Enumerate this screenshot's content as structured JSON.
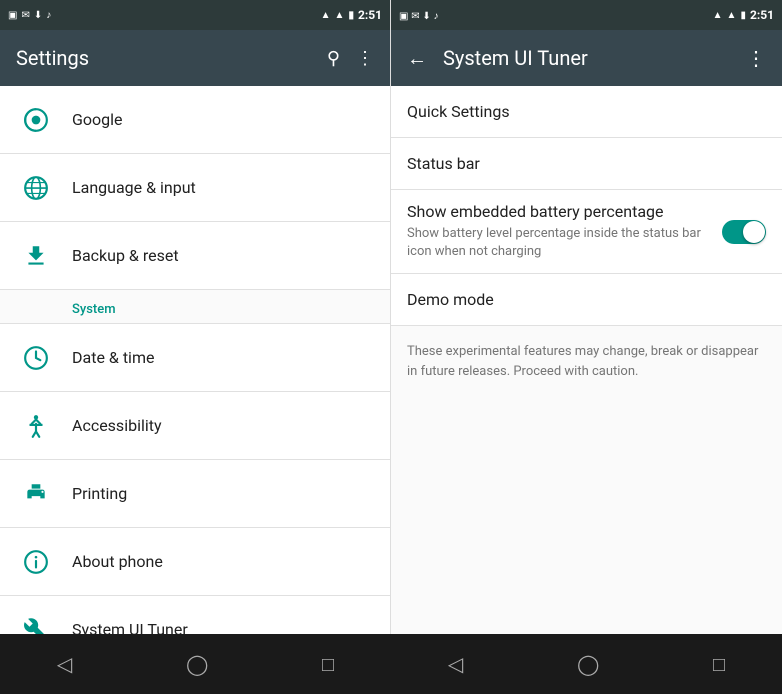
{
  "left": {
    "status_bar": {
      "time": "2:51",
      "icons": [
        "notification1",
        "notification2",
        "notification3",
        "notification4"
      ]
    },
    "header": {
      "title": "Settings",
      "search_label": "search",
      "more_label": "more options"
    },
    "items": [
      {
        "id": "google",
        "label": "Google",
        "icon": "google"
      },
      {
        "id": "language",
        "label": "Language & input",
        "icon": "language"
      },
      {
        "id": "backup",
        "label": "Backup & reset",
        "icon": "backup"
      }
    ],
    "section": "System",
    "system_items": [
      {
        "id": "datetime",
        "label": "Date & time",
        "icon": "clock"
      },
      {
        "id": "accessibility",
        "label": "Accessibility",
        "icon": "accessibility"
      },
      {
        "id": "printing",
        "label": "Printing",
        "icon": "print"
      },
      {
        "id": "about",
        "label": "About phone",
        "icon": "info"
      },
      {
        "id": "tuner",
        "label": "System UI Tuner",
        "icon": "wrench"
      }
    ]
  },
  "right": {
    "status_bar": {
      "time": "2:51"
    },
    "header": {
      "title": "System UI Tuner",
      "back_label": "back"
    },
    "items": [
      {
        "id": "quick-settings",
        "label": "Quick Settings",
        "type": "nav"
      },
      {
        "id": "status-bar",
        "label": "Status bar",
        "type": "nav"
      },
      {
        "id": "battery-pct",
        "label": "Show embedded battery percentage",
        "description": "Show battery level percentage inside the status bar icon when not charging",
        "type": "toggle",
        "enabled": true
      },
      {
        "id": "demo-mode",
        "label": "Demo mode",
        "type": "nav"
      }
    ],
    "note": "These experimental features may change, break or disappear in future releases. Proceed with caution."
  },
  "nav": {
    "back": "◁",
    "home": "○",
    "recent": "□"
  }
}
